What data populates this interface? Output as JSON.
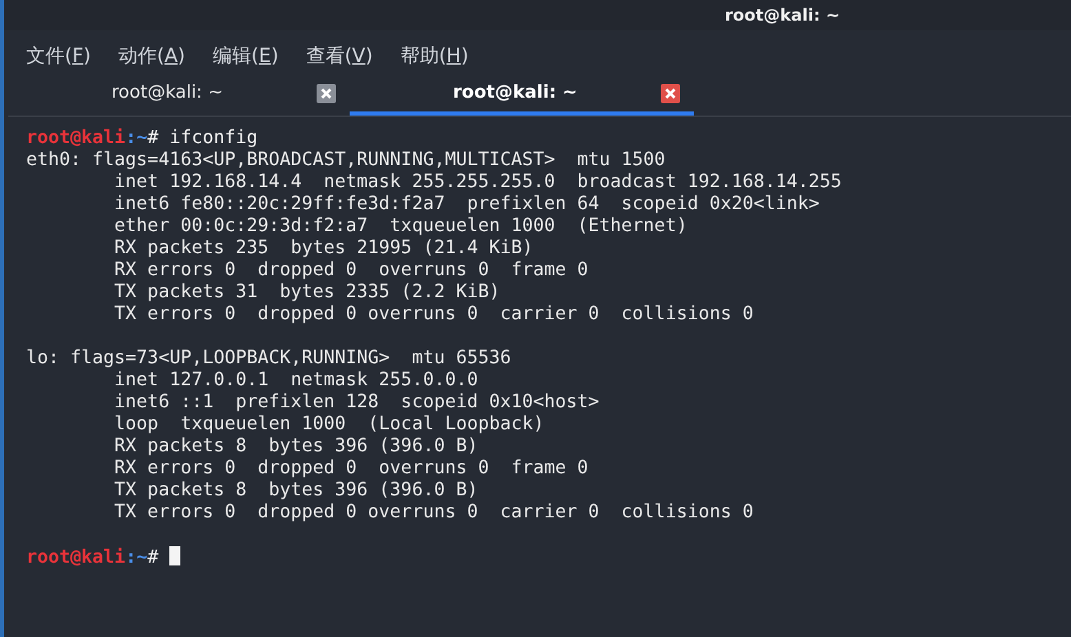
{
  "window": {
    "title": "root@kali: ~"
  },
  "menu": [
    {
      "prefix": "文件(",
      "key": "F",
      "suffix": ")"
    },
    {
      "prefix": "动作(",
      "key": "A",
      "suffix": ")"
    },
    {
      "prefix": "编辑(",
      "key": "E",
      "suffix": ")"
    },
    {
      "prefix": "查看(",
      "key": "V",
      "suffix": ")"
    },
    {
      "prefix": "帮助(",
      "key": "H",
      "suffix": ")"
    }
  ],
  "tabs": [
    {
      "label": "root@kali: ~",
      "selected": false
    },
    {
      "label": "root@kali: ~",
      "selected": true
    }
  ],
  "terminal": {
    "lines": [
      {
        "kind": "prompt",
        "user": "root@kali",
        "path": ":~",
        "command": "# ifconfig"
      },
      {
        "kind": "output",
        "text": "eth0: flags=4163<UP,BROADCAST,RUNNING,MULTICAST>  mtu 1500"
      },
      {
        "kind": "output",
        "text": "        inet 192.168.14.4  netmask 255.255.255.0  broadcast 192.168.14.255"
      },
      {
        "kind": "output",
        "text": "        inet6 fe80::20c:29ff:fe3d:f2a7  prefixlen 64  scopeid 0x20<link>"
      },
      {
        "kind": "output",
        "text": "        ether 00:0c:29:3d:f2:a7  txqueuelen 1000  (Ethernet)"
      },
      {
        "kind": "output",
        "text": "        RX packets 235  bytes 21995 (21.4 KiB)"
      },
      {
        "kind": "output",
        "text": "        RX errors 0  dropped 0  overruns 0  frame 0"
      },
      {
        "kind": "output",
        "text": "        TX packets 31  bytes 2335 (2.2 KiB)"
      },
      {
        "kind": "output",
        "text": "        TX errors 0  dropped 0 overruns 0  carrier 0  collisions 0"
      },
      {
        "kind": "blank"
      },
      {
        "kind": "output",
        "text": "lo: flags=73<UP,LOOPBACK,RUNNING>  mtu 65536"
      },
      {
        "kind": "output",
        "text": "        inet 127.0.0.1  netmask 255.0.0.0"
      },
      {
        "kind": "output",
        "text": "        inet6 ::1  prefixlen 128  scopeid 0x10<host>"
      },
      {
        "kind": "output",
        "text": "        loop  txqueuelen 1000  (Local Loopback)"
      },
      {
        "kind": "output",
        "text": "        RX packets 8  bytes 396 (396.0 B)"
      },
      {
        "kind": "output",
        "text": "        RX errors 0  dropped 0  overruns 0  frame 0"
      },
      {
        "kind": "output",
        "text": "        TX packets 8  bytes 396 (396.0 B)"
      },
      {
        "kind": "output",
        "text": "        TX errors 0  dropped 0 overruns 0  carrier 0  collisions 0"
      },
      {
        "kind": "blank"
      },
      {
        "kind": "prompt",
        "user": "root@kali",
        "path": ":~",
        "command": "# ",
        "cursor": true
      }
    ]
  }
}
